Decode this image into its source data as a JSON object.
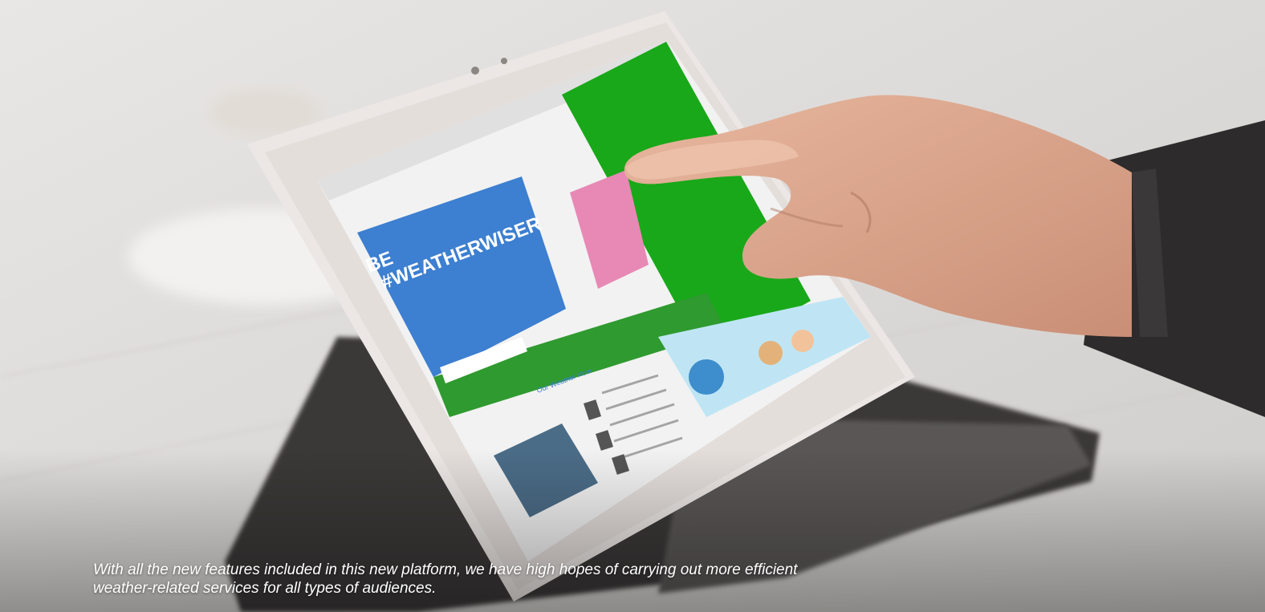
{
  "photo": {
    "description_icon": "tablet-photo-icon",
    "screen_content": {
      "hero_lines": [
        "BE",
        "#WEATHERWISER"
      ],
      "section_heading": "Our Weather Now"
    }
  },
  "caption": {
    "line1": "With all the new features included in this new platform, we have high hopes of carrying out more efficient",
    "line2": "weather-related services for all types of audiences."
  },
  "colors": {
    "brand_green": "#1fa81f",
    "hero_blue": "#3d7fd0",
    "tablet_frame": "#ece7e4"
  }
}
